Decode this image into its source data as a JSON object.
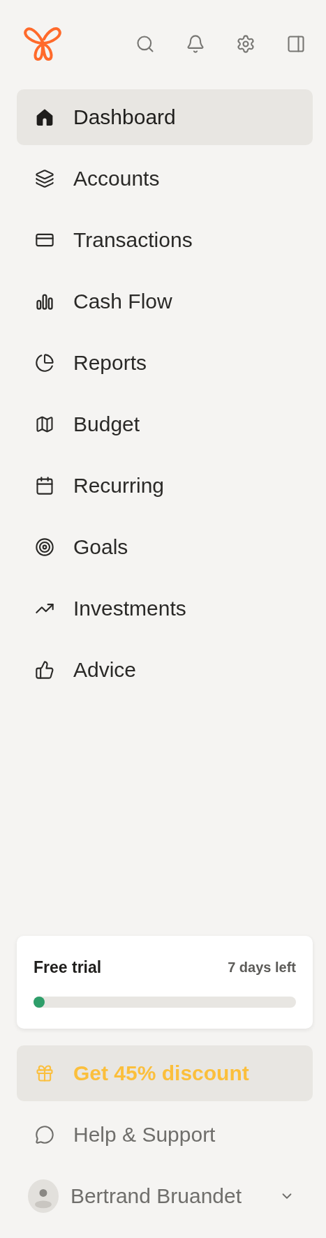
{
  "nav": [
    {
      "label": "Dashboard",
      "selected": true
    },
    {
      "label": "Accounts",
      "selected": false
    },
    {
      "label": "Transactions",
      "selected": false
    },
    {
      "label": "Cash Flow",
      "selected": false
    },
    {
      "label": "Reports",
      "selected": false
    },
    {
      "label": "Budget",
      "selected": false
    },
    {
      "label": "Recurring",
      "selected": false
    },
    {
      "label": "Goals",
      "selected": false
    },
    {
      "label": "Investments",
      "selected": false
    },
    {
      "label": "Advice",
      "selected": false
    }
  ],
  "trial": {
    "title": "Free trial",
    "remaining": "7 days left",
    "level": 0.02
  },
  "discount": {
    "label": "Get 45% discount"
  },
  "help": {
    "label": "Help & Support"
  },
  "user": {
    "name": "Bertrand Bruandet"
  }
}
